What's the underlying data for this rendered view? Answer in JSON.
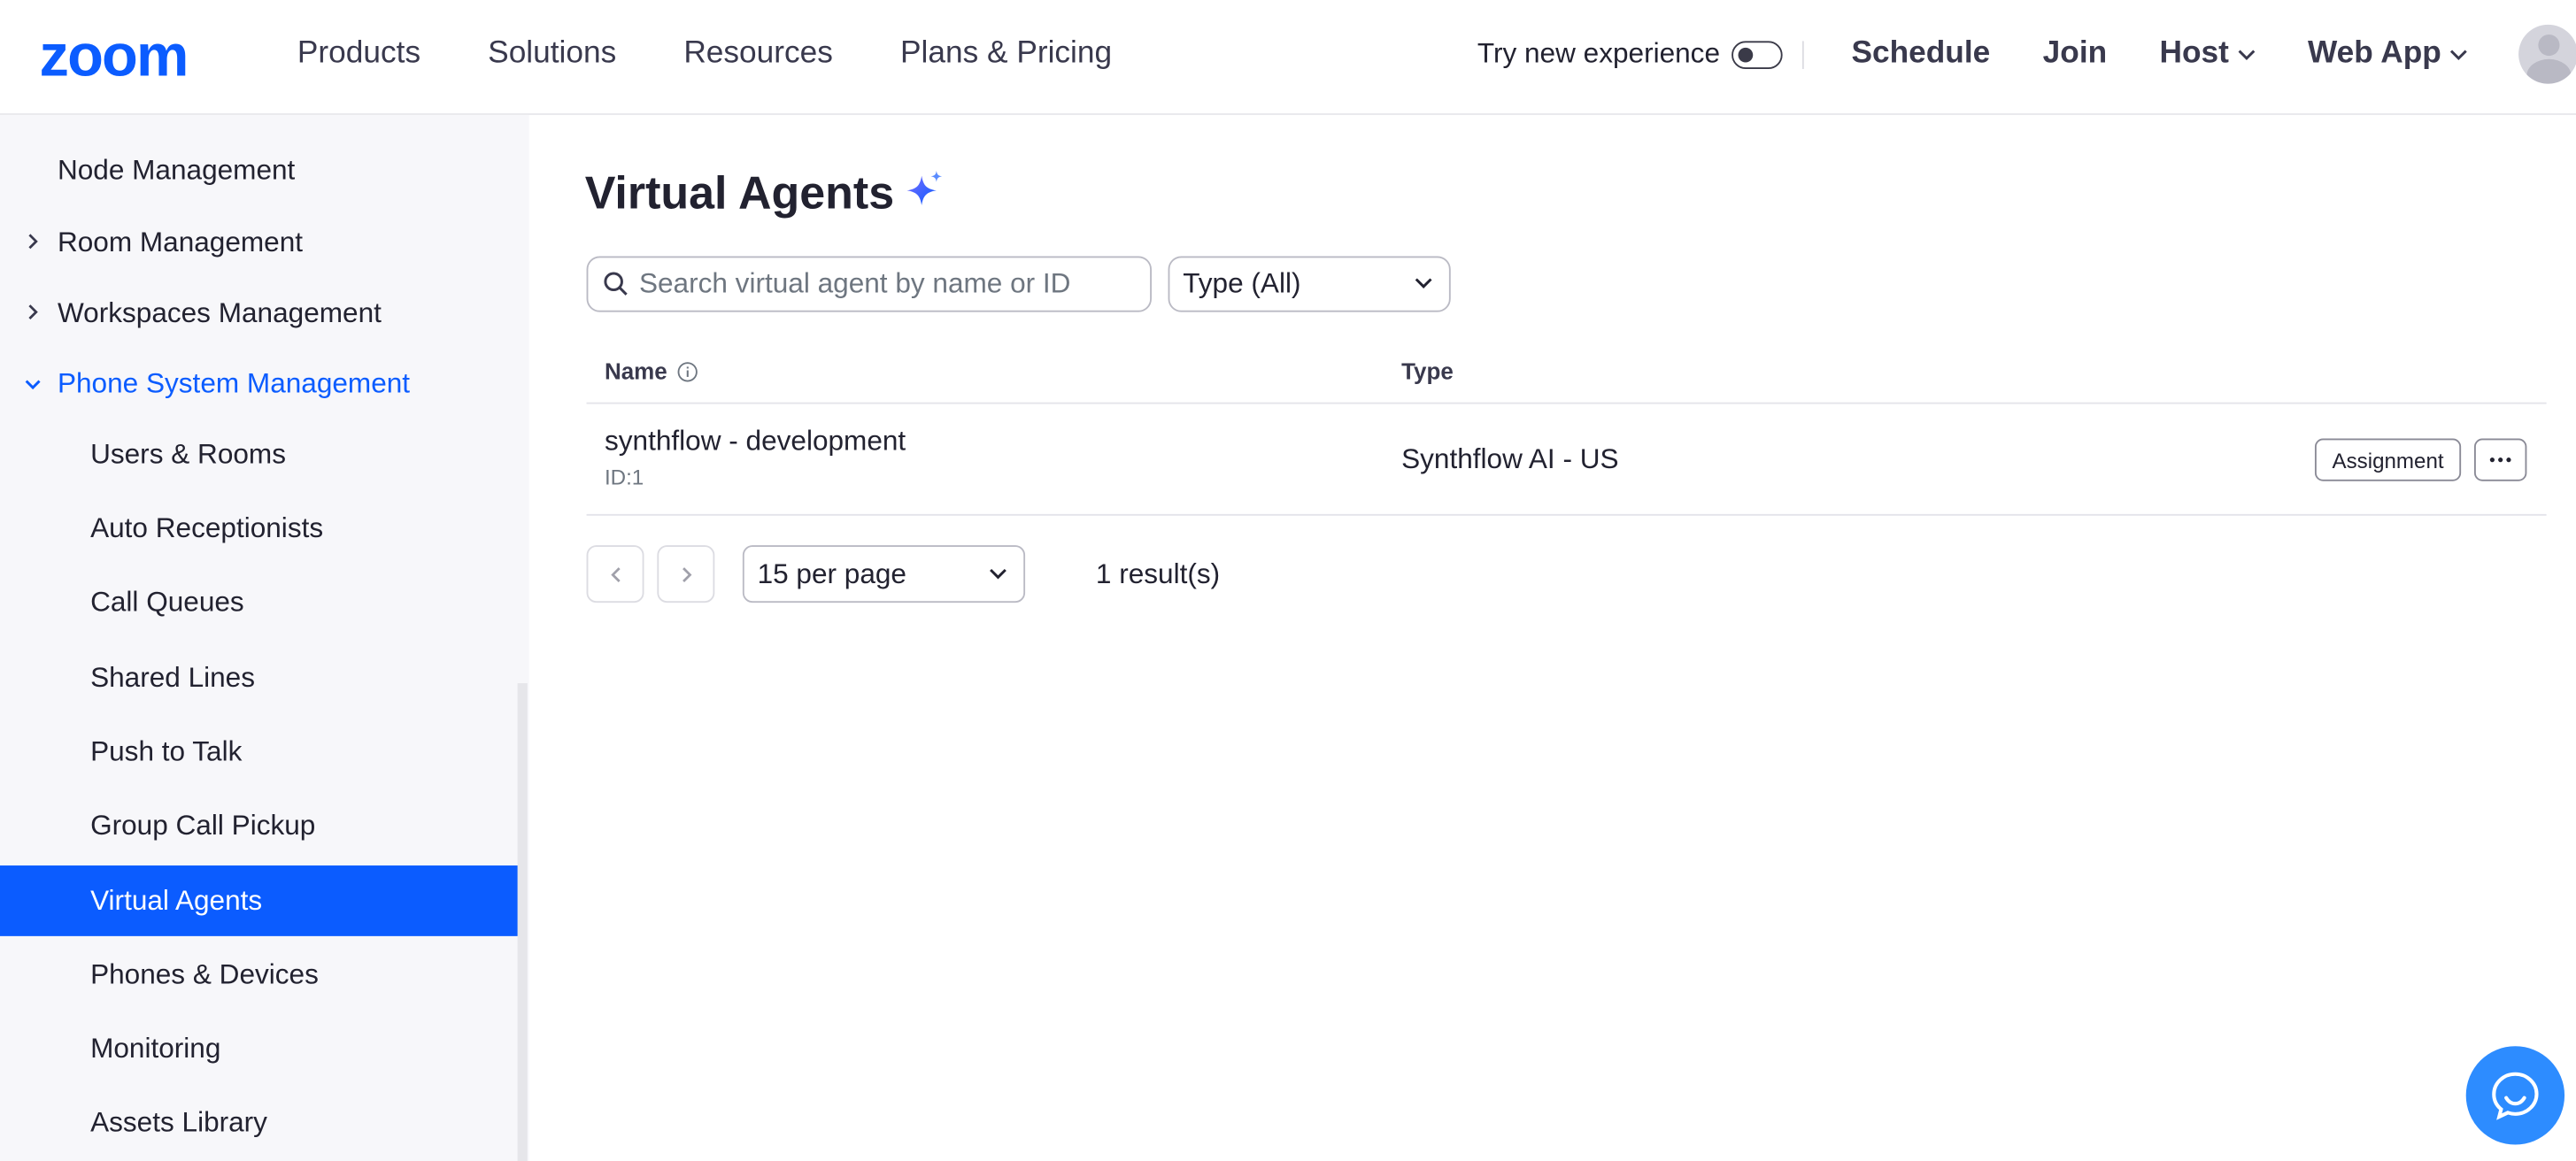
{
  "header": {
    "logo_text": "zoom",
    "nav_links": [
      "Products",
      "Solutions",
      "Resources",
      "Plans & Pricing"
    ],
    "try_new_experience": "Try new experience",
    "toggle_on": false,
    "schedule": "Schedule",
    "join": "Join",
    "host": "Host",
    "web_app": "Web App"
  },
  "sidebar": {
    "items": [
      {
        "label": "Node Management",
        "level": 0,
        "caret": "none"
      },
      {
        "label": "Room Management",
        "level": 0,
        "caret": "right"
      },
      {
        "label": "Workspaces Management",
        "level": 0,
        "caret": "right"
      },
      {
        "label": "Phone System Management",
        "level": 0,
        "caret": "down",
        "expanded": true
      },
      {
        "label": "Users & Rooms",
        "level": 1
      },
      {
        "label": "Auto Receptionists",
        "level": 1
      },
      {
        "label": "Call Queues",
        "level": 1
      },
      {
        "label": "Shared Lines",
        "level": 1
      },
      {
        "label": "Push to Talk",
        "level": 1
      },
      {
        "label": "Group Call Pickup",
        "level": 1
      },
      {
        "label": "Virtual Agents",
        "level": 1,
        "active": true
      },
      {
        "label": "Phones & Devices",
        "level": 1
      },
      {
        "label": "Monitoring",
        "level": 1
      },
      {
        "label": "Assets Library",
        "level": 1
      }
    ]
  },
  "main": {
    "title": "Virtual Agents",
    "search_placeholder": "Search virtual agent by name or ID",
    "type_filter": "Type (All)",
    "table": {
      "col_name": "Name",
      "col_type": "Type",
      "rows": [
        {
          "name": "synthflow - development",
          "id": "ID:1",
          "type": "Synthflow AI - US",
          "action": "Assignment"
        }
      ]
    },
    "per_page": "15 per page",
    "result_count": "1 result(s)"
  },
  "colors": {
    "accent": "#0b5cff",
    "sidebar_bg": "#f7f7fa",
    "chat_button": "#2d8cff"
  },
  "icons": [
    "search-icon",
    "chevron-down-icon",
    "chevron-right-icon",
    "info-icon",
    "sparkle-icon",
    "more-icon",
    "chat-icon"
  ]
}
